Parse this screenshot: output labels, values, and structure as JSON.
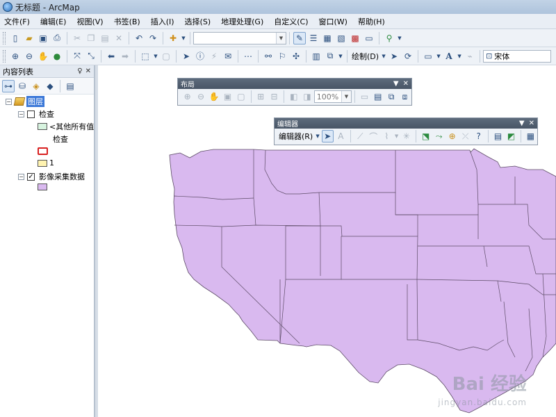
{
  "window": {
    "title": "无标题 - ArcMap"
  },
  "menu": [
    "文件(F)",
    "编辑(E)",
    "视图(V)",
    "书签(B)",
    "插入(I)",
    "选择(S)",
    "地理处理(G)",
    "自定义(C)",
    "窗口(W)",
    "帮助(H)"
  ],
  "toolbar2": {
    "draw_label": "绘制(D)",
    "font_value": "宋体"
  },
  "toc": {
    "title": "内容列表",
    "pin": "♀",
    "close": "✕",
    "root": "图层",
    "group": "检查",
    "other_values": "<其他所有值",
    "field": "检查",
    "class_label": "1",
    "layer2": "影像采集数据"
  },
  "layout_toolbar": {
    "title": "布局",
    "zoom": "100%"
  },
  "editor_toolbar": {
    "title": "编辑器",
    "menu_label": "编辑器(R)"
  },
  "watermark": {
    "main": "Bai 经验",
    "sub": "jingyan.baidu.com"
  },
  "colors": {
    "map_fill": "#d9b9ef",
    "map_stroke": "#5c4b66",
    "symbol_green": "#d7f3df",
    "symbol_red": "#d82020",
    "symbol_yellow": "#fff3b0",
    "symbol_purple": "#d9b9ef"
  }
}
